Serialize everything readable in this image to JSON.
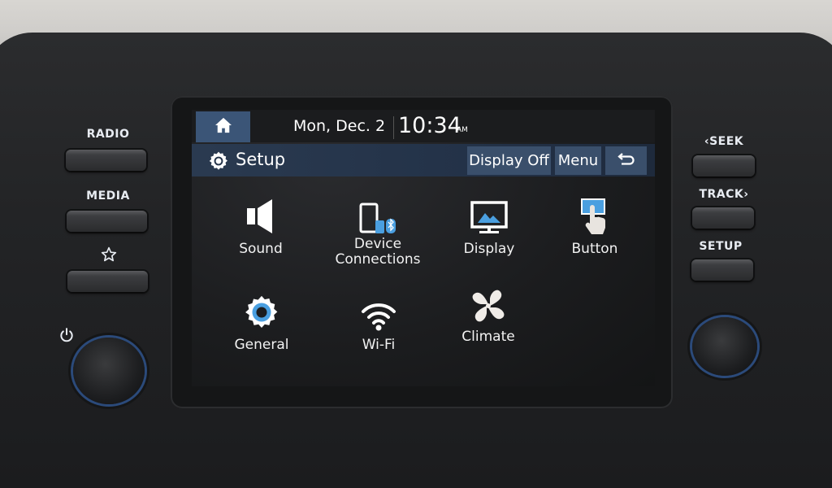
{
  "status_bar": {
    "home_icon": "home-icon",
    "date": "Mon, Dec. 2",
    "time": "10:34",
    "ampm": "AM"
  },
  "title_bar": {
    "icon": "gear-icon",
    "title": "Setup",
    "buttons": {
      "display_off": "Display Off",
      "menu": "Menu",
      "back_icon": "back-arrow-icon"
    }
  },
  "setup_items": [
    {
      "label": "Sound",
      "icon": "speaker-icon"
    },
    {
      "label": "Device\nConnections",
      "line1": "Device",
      "line2": "Connections",
      "icon": "device-connections-icon"
    },
    {
      "label": "Display",
      "icon": "display-icon"
    },
    {
      "label": "Button",
      "icon": "touch-button-icon"
    },
    {
      "label": "General",
      "icon": "gear-icon"
    },
    {
      "label": "Wi-Fi",
      "icon": "wifi-icon"
    },
    {
      "label": "Climate",
      "icon": "fan-icon"
    }
  ],
  "hardware_left": {
    "radio": "RADIO",
    "media": "MEDIA",
    "favorite_icon": "star-icon",
    "power_icon": "power-icon"
  },
  "hardware_right": {
    "seek": "‹SEEK",
    "track": "TRACK›",
    "setup": "SETUP"
  },
  "colors": {
    "accent": "#3b5577",
    "title_bar": "#233248",
    "icon_blue": "#4a9fe0"
  }
}
